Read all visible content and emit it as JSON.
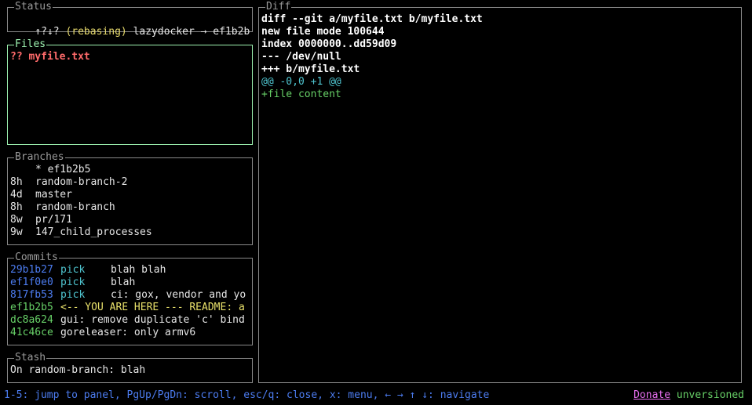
{
  "status": {
    "title": "Status",
    "arrows": "↑?↓?",
    "state": "(rebasing)",
    "repo": "lazydocker → ef1b2b5"
  },
  "files": {
    "title": "Files",
    "items": [
      {
        "status": "??",
        "name": "myfile.txt"
      }
    ]
  },
  "branches": {
    "title": "Branches",
    "items": [
      {
        "age": "",
        "name": "* ef1b2b5"
      },
      {
        "age": "8h",
        "name": "random-branch-2"
      },
      {
        "age": "4d",
        "name": "master"
      },
      {
        "age": "8h",
        "name": "random-branch"
      },
      {
        "age": "8w",
        "name": "pr/171"
      },
      {
        "age": "9w",
        "name": "147_child_processes"
      }
    ]
  },
  "commits": {
    "title": "Commits",
    "items": [
      {
        "hash": "29b1b27",
        "action": "pick",
        "message": "blah blah",
        "hash_color": "#4c7cf0",
        "action_color": "#4fc4cf",
        "msg_color": "#e6e6e6"
      },
      {
        "hash": "ef1f0e0",
        "action": "pick",
        "message": "blah",
        "hash_color": "#4c7cf0",
        "action_color": "#4fc4cf",
        "msg_color": "#e6e6e6"
      },
      {
        "hash": "817fb53",
        "action": "pick",
        "message": "ci: gox, vendor and yo",
        "hash_color": "#4c7cf0",
        "action_color": "#4fc4cf",
        "msg_color": "#e6e6e6"
      },
      {
        "hash": "ef1b2b5",
        "action": "",
        "message": "<-- YOU ARE HERE --- README: a",
        "hash_color": "#67d067",
        "action_color": "#e8e06a",
        "msg_color": "#e8e06a"
      },
      {
        "hash": "dc8a624",
        "action": "",
        "message": "gui: remove duplicate 'c' bind",
        "hash_color": "#67d067",
        "action_color": "#e6e6e6",
        "msg_color": "#e6e6e6"
      },
      {
        "hash": "41c46ce",
        "action": "",
        "message": "goreleaser: only armv6",
        "hash_color": "#67d067",
        "action_color": "#e6e6e6",
        "msg_color": "#e6e6e6"
      }
    ]
  },
  "stash": {
    "title": "Stash",
    "items": [
      "On random-branch: blah"
    ]
  },
  "diff": {
    "title": "Diff",
    "lines": [
      {
        "text": "diff --git a/myfile.txt b/myfile.txt",
        "kind": "header"
      },
      {
        "text": "new file mode 100644",
        "kind": "header"
      },
      {
        "text": "index 0000000..dd59d09",
        "kind": "header"
      },
      {
        "text": "--- /dev/null",
        "kind": "header"
      },
      {
        "text": "+++ b/myfile.txt",
        "kind": "header"
      },
      {
        "text": "@@ -0,0 +1 @@",
        "kind": "hunk"
      },
      {
        "text": "+file content",
        "kind": "add"
      }
    ]
  },
  "footer": {
    "keybindings": "1-5: jump to panel, PgUp/PgDn: scroll, esc/q: close, x: menu, ← → ↑ ↓: navigate",
    "donate": "Donate",
    "version": "unversioned"
  },
  "colors": {
    "active_border": "#9df2b0",
    "inactive_border": "#8a8a8a",
    "keybinding_text": "#4c7cf0",
    "donate": "#e86ff0",
    "version": "#67d067"
  }
}
